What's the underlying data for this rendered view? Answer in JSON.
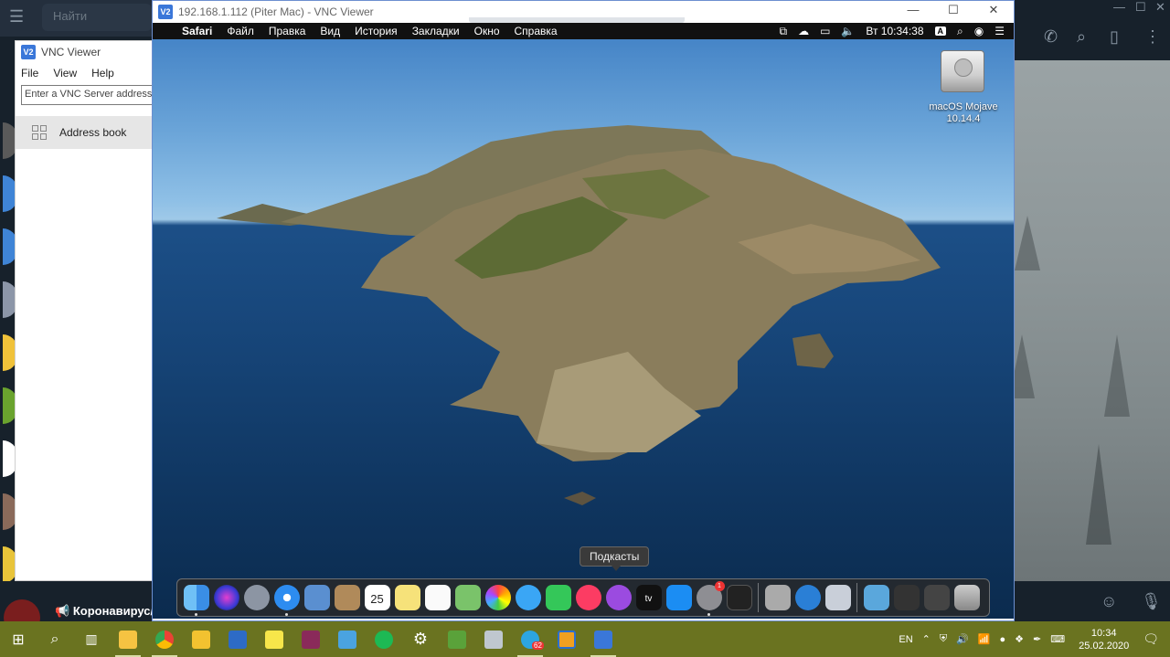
{
  "telegram": {
    "search_placeholder": "Найти",
    "pinned_message": "Коронавирус/..."
  },
  "vnc_small": {
    "title": "VNC Viewer",
    "menu": [
      "File",
      "View",
      "Help"
    ],
    "address_placeholder": "Enter a VNC Server address o",
    "address_book": "Address book"
  },
  "vnc_main": {
    "title": "192.168.1.112 (Piter Mac) - VNC Viewer",
    "controls": [
      "—",
      "☐",
      "✕"
    ]
  },
  "mac": {
    "menubar": {
      "app": "Safari",
      "items": [
        "Файл",
        "Правка",
        "Вид",
        "История",
        "Закладки",
        "Окно",
        "Справка"
      ],
      "clock": "Вт 10:34:38",
      "input_badge": "A"
    },
    "desktop_disk": {
      "name": "macOS Mojave",
      "version": "10.14.4"
    },
    "dock_tooltip": "Подкасты",
    "calendar_day": "25",
    "dock_badge": "1",
    "tv_label": "tv"
  },
  "taskbar": {
    "language": "EN",
    "time": "10:34",
    "date": "25.02.2020",
    "telegram_badge": "62"
  },
  "colors": {
    "taskbar": "#6a7320",
    "telegram_bg": "#17212b",
    "vnc_accent": "#3a77d9"
  }
}
